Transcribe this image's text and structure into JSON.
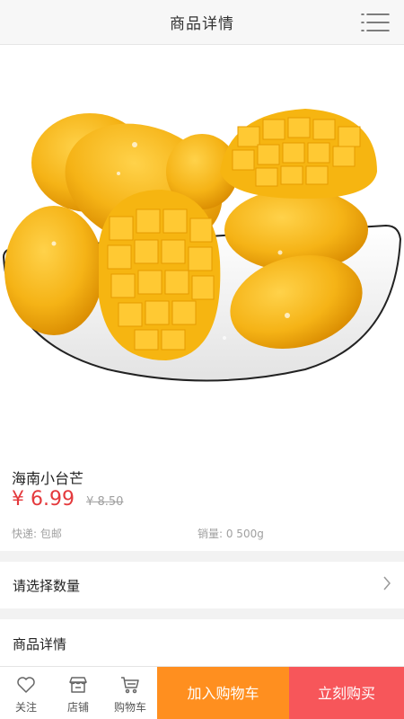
{
  "header": {
    "title": "商品详情",
    "menu_icon": "list-menu-icon"
  },
  "product": {
    "image_icon": "mango-photo",
    "name": "海南小台芒",
    "price": "¥ 6.99",
    "original_price": "¥ 8.50",
    "shipping": "快递: 包邮",
    "sales": "销量: 0 500g"
  },
  "quantity_row": {
    "label": "请选择数量"
  },
  "details_row": {
    "label": "商品详情"
  },
  "bottom_bar": {
    "follow": {
      "label": "关注",
      "icon": "heart-icon"
    },
    "shop": {
      "label": "店铺",
      "icon": "store-icon"
    },
    "cart": {
      "label": "购物车",
      "icon": "cart-icon"
    },
    "add_to_cart": "加入购物车",
    "buy_now": "立刻购买"
  },
  "colors": {
    "price": "#e4393c",
    "add_to_cart_bg": "#ff8f1f",
    "buy_now_bg": "#f7565a",
    "section_gap": "#f2f2f2"
  }
}
